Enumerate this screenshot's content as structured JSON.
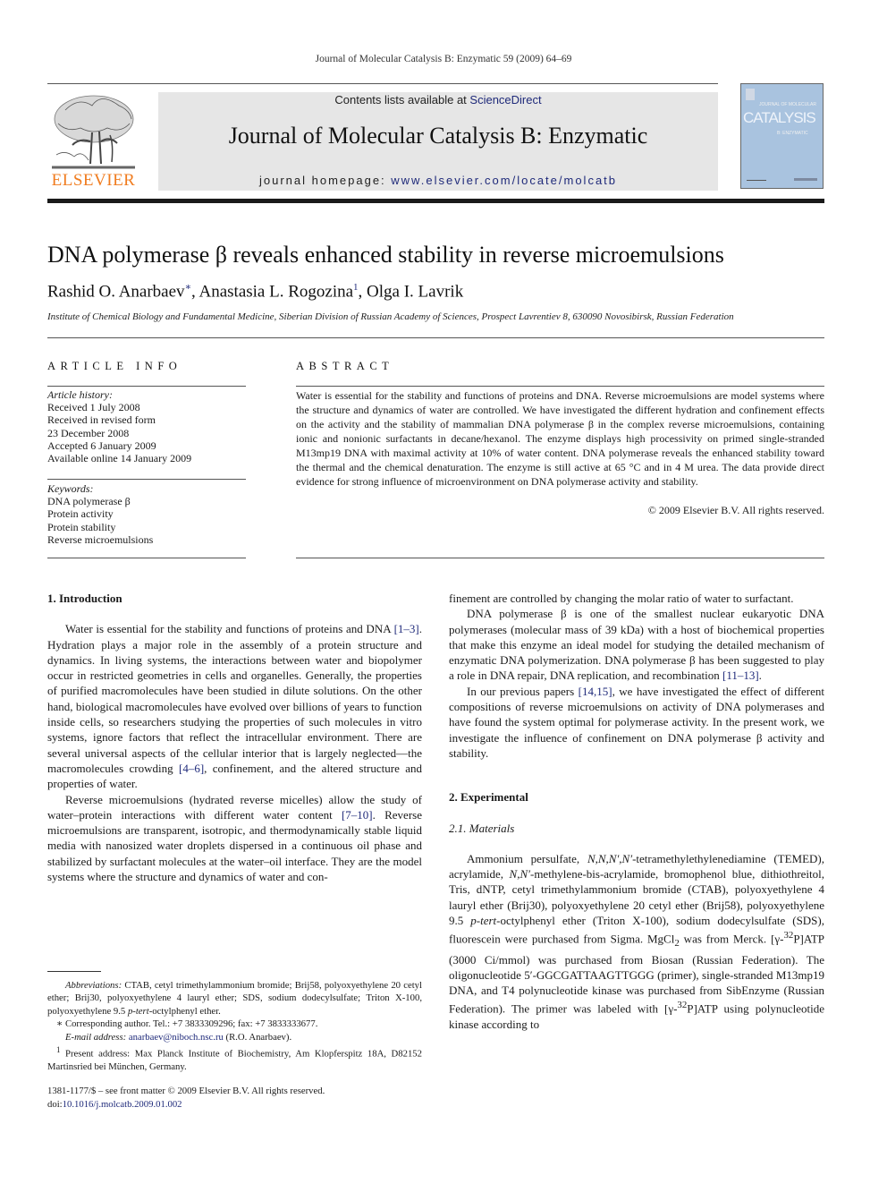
{
  "running_head": "Journal of Molecular Catalysis B: Enzymatic 59 (2009) 64–69",
  "masthead": {
    "publisher_logo_text": "ELSEVIER",
    "contents_prefix": "Contents lists available at ",
    "contents_link": "ScienceDirect",
    "journal_title": "Journal of Molecular Catalysis B: Enzymatic",
    "homepage_prefix": "journal homepage: ",
    "homepage_link": "www.elsevier.com/locate/molcatb",
    "cover": {
      "small_title": "JOURNAL OF MOLECULAR",
      "big_title": "CATALYSIS",
      "subtitle": "B: ENZYMATIC"
    },
    "colors": {
      "elsevier_orange": "#f07c1f",
      "banner_gray": "#e6e6e6",
      "link_blue": "#1f2a7a",
      "cover_blue": "#a9c3df"
    }
  },
  "article": {
    "title": "DNA polymerase β reveals enhanced stability in reverse microemulsions",
    "authors": [
      {
        "name": "Rashid O. Anarbaev",
        "mark": "∗",
        "sep": ", "
      },
      {
        "name": "Anastasia L. Rogozina",
        "mark": "1",
        "sep": ", "
      },
      {
        "name": "Olga I. Lavrik",
        "mark": "",
        "sep": ""
      }
    ],
    "affiliation": "Institute of Chemical Biology and Fundamental Medicine, Siberian Division of Russian Academy of Sciences, Prospect Lavrentiev 8, 630090 Novosibirsk, Russian Federation"
  },
  "article_info": {
    "label": "ARTICLE INFO",
    "history_label": "Article history:",
    "history": [
      "Received 1 July 2008",
      "Received in revised form",
      "23 December 2008",
      "Accepted 6 January 2009",
      "Available online 14 January 2009"
    ],
    "keywords_label": "Keywords:",
    "keywords": [
      "DNA polymerase β",
      "Protein activity",
      "Protein stability",
      "Reverse microemulsions"
    ]
  },
  "abstract": {
    "label": "ABSTRACT",
    "text": "Water is essential for the stability and functions of proteins and DNA. Reverse microemulsions are model systems where the structure and dynamics of water are controlled. We have investigated the different hydration and confinement effects on the activity and the stability of mammalian DNA polymerase β in the complex reverse microemulsions, containing ionic and nonionic surfactants in decane/hexanol. The enzyme displays high processivity on primed single-stranded M13mp19 DNA with maximal activity at 10% of water content. DNA polymerase reveals the enhanced stability toward the thermal and the chemical denaturation. The enzyme is still active at 65 °C and in 4 M urea. The data provide direct evidence for strong influence of microenvironment on DNA polymerase activity and stability.",
    "copyright": "© 2009 Elsevier B.V. All rights reserved."
  },
  "body": {
    "intro_heading": "1.  Introduction",
    "intro_p1": [
      "Water is essential for the stability and functions of proteins and DNA ",
      "[1–3]",
      ". Hydration plays a major role in the assembly of a protein structure and dynamics. In living systems, the interactions between water and biopolymer occur in restricted geometries in cells and organelles. Generally, the properties of purified macromolecules have been studied in dilute solutions. On the other hand, biological macromolecules have evolved over billions of years to function inside cells, so researchers studying the properties of such molecules in vitro systems, ignore factors that reflect the intracellular environment. There are several universal aspects of the cellular interior that is largely neglected—the macromolecules crowding ",
      "[4–6]",
      ", confinement, and the altered structure and properties of water."
    ],
    "intro_p2": [
      "Reverse microemulsions (hydrated reverse micelles) allow the study of water–protein interactions with different water content ",
      "[7–10]",
      ". Reverse microemulsions are transparent, isotropic, and thermodynamically stable liquid media with nanosized water droplets dispersed in a continuous oil phase and stabilized by surfactant molecules at the water–oil interface. They are the model systems where the structure and dynamics of water and con-"
    ],
    "right_p0": "finement are controlled by changing the molar ratio of water to surfactant.",
    "right_p1": [
      "DNA polymerase β is one of the smallest nuclear eukaryotic DNA polymerases (molecular mass of 39 kDa) with a host of biochemical properties that make this enzyme an ideal model for studying the detailed mechanism of enzymatic DNA polymerization. DNA polymerase β has been suggested to play a role in DNA repair, DNA replication, and recombination ",
      "[11–13]",
      "."
    ],
    "right_p2": [
      "In our previous papers ",
      "[14,15]",
      ", we have investigated the effect of different compositions of reverse microemulsions on activity of DNA polymerases and have found the system optimal for polymerase activity. In the present work, we investigate the influence of confinement on DNA polymerase β activity and stability."
    ],
    "exp_heading": "2.  Experimental",
    "materials_heading": "2.1.  Materials",
    "materials_p": {
      "t1": "Ammonium persulfate, ",
      "i1": "N,N,N′,N′",
      "t2": "-tetramethylethylenediamine (TEMED), acrylamide, ",
      "i2": "N,N′",
      "t3": "-methylene-bis-acrylamide, bromophenol blue, dithiothreitol, Tris, dNTP, cetyl trimethylammonium bromide (CTAB), polyoxyethylene 4 lauryl ether (Brij30), polyoxyethylene 20 cetyl ether (Brij58), polyoxyethylene 9.5 ",
      "i3": "p-tert",
      "t4": "-octylphenyl ether (Triton X-100), sodium dodecylsulfate (SDS), fluorescein were purchased from Sigma. MgCl",
      "sub1": "2",
      "t5": " was from Merck. [γ-",
      "sup1": "32",
      "t6": "P]ATP (3000 Ci/mmol) was purchased from Biosan (Russian Federation). The oligonucleotide 5′-GGCGATTAAGTTGGG (primer), single-stranded M13mp19 DNA, and T4 polynucleotide kinase was purchased from SibEnzyme (Russian Federation). The primer was labeled with [γ-",
      "sup2": "32",
      "t7": "P]ATP using polynucleotide kinase according to"
    }
  },
  "footnotes": {
    "abbrev_label": "Abbreviations:",
    "abbrev_text": "  CTAB, cetyl trimethylammonium bromide; Brij58, polyoxyethylene 20 cetyl ether; Brij30, polyoxyethylene 4 lauryl ether; SDS, sodium dodecylsulfate; Triton X-100, polyoxyethylene 9.5 ",
    "abbrev_italic": "p-tert",
    "abbrev_tail": "-octylphenyl ether.",
    "corr_mark": "∗",
    "corr_text": "  Corresponding author. Tel.: +7 3833309296; fax: +7 3833333677.",
    "email_label": "E-mail address:",
    "email": "anarbaev@niboch.nsc.ru",
    "email_tail": " (R.O. Anarbaev).",
    "present_mark": "1",
    "present_text": " Present address: Max Planck Institute of Biochemistry, Am Klopferspitz 18A, D82152 Martinsried bei München, Germany."
  },
  "front_matter": {
    "issn_line": "1381-1177/$ – see front matter © 2009 Elsevier B.V. All rights reserved.",
    "doi_prefix": "doi:",
    "doi": "10.1016/j.molcatb.2009.01.002"
  }
}
